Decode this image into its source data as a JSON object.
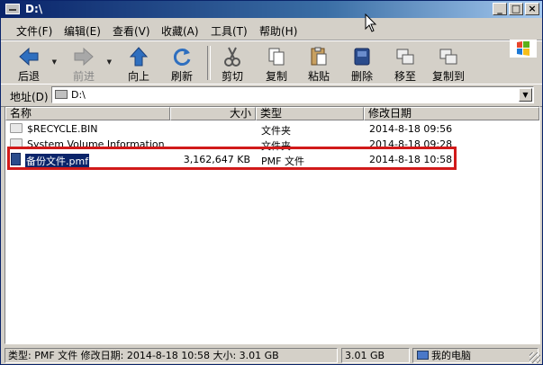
{
  "window": {
    "title": "D:\\"
  },
  "menu": [
    {
      "id": "file",
      "label": "文件(F)"
    },
    {
      "id": "edit",
      "label": "编辑(E)"
    },
    {
      "id": "view",
      "label": "查看(V)"
    },
    {
      "id": "favorites",
      "label": "收藏(A)"
    },
    {
      "id": "tools",
      "label": "工具(T)"
    },
    {
      "id": "help",
      "label": "帮助(H)"
    }
  ],
  "toolbar": {
    "back": "后退",
    "forward": "前进",
    "up": "向上",
    "refresh": "刷新",
    "cut": "剪切",
    "copy": "复制",
    "paste": "粘贴",
    "delete": "删除",
    "move_to": "移至",
    "copy_to": "复制到"
  },
  "address": {
    "label": "地址(D)",
    "value": "D:\\"
  },
  "columns": {
    "name": "名称",
    "size": "大小",
    "type": "类型",
    "modified": "修改日期"
  },
  "files": [
    {
      "name": "$RECYCLE.BIN",
      "size": "",
      "type": "文件夹",
      "modified": "2014-8-18 09:56",
      "icon": "folder-icon"
    },
    {
      "name": "System Volume Information",
      "size": "",
      "type": "文件夹",
      "modified": "2014-8-18 09:28",
      "icon": "folder-icon"
    },
    {
      "name": "备份文件.pmf",
      "size": "3,162,647 KB",
      "type": "PMF 文件",
      "modified": "2014-8-18 10:58",
      "icon": "document-icon",
      "selected": true
    }
  ],
  "status": {
    "info": "类型: PMF 文件 修改日期: 2014-8-18 10:58 大小: 3.01 GB",
    "size": "3.01 GB",
    "location": "我的电脑"
  }
}
